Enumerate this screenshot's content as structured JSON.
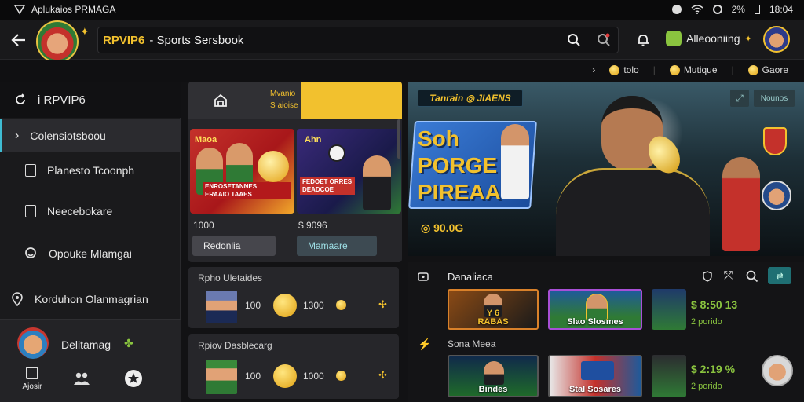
{
  "status_bar": {
    "app_title": "Aplukaios PRMAGA",
    "battery": "2%",
    "time": "18:04"
  },
  "top_bar": {
    "brand": "RPVIP6",
    "subtitle": "- Sports Sersbook",
    "account_label": "Alleooniing"
  },
  "sub_bar": {
    "items": [
      "tolo",
      "Mutique",
      "Gaore"
    ]
  },
  "sidebar": {
    "header": "i RPVIP6",
    "items": [
      "Colensiotsboou",
      "Planesto Tcoonph",
      "Neecebokare",
      "Opouke Mlamgai"
    ],
    "footer_item": "Korduhon Olanmagrian",
    "profile_name": "Delitamag",
    "bottom_label": "Ajosir"
  },
  "promo": {
    "tab_text": "Mvanio\nS aioise",
    "cards": [
      {
        "top": "Maoa",
        "banner": "ENROSETANNES\nERAAIO TAAES",
        "amount": "1000",
        "button": "Redonlia"
      },
      {
        "top": "Ahn",
        "banner": "FEDOET ORRES\nDEADCOE",
        "amount": "$ 9096",
        "button": "Mamaare"
      }
    ]
  },
  "rows": [
    {
      "title": "Rpho Uletaides",
      "value1": "100",
      "value2": "1300"
    },
    {
      "title": "Rpiov Dasblecarg",
      "value1": "100",
      "value2": "1000"
    }
  ],
  "hero": {
    "tag": "Tanrain ◎ JIAENS",
    "headline": "Soh PORGE PIREAA",
    "price": "◎ 90.0G",
    "button": "Nounos"
  },
  "games": {
    "header": "Danaliaca",
    "subheader": "Sona Meea",
    "row1": [
      {
        "label": "Y 6\nRABAS",
        "style": "orange"
      },
      {
        "label": "Slao Slosmes",
        "style": "purple"
      }
    ],
    "row1_price": "$ 8:50 13",
    "row1_sub": "2 porido",
    "row2": [
      {
        "label": "Bindes",
        "style": "green"
      },
      {
        "label": "Stal Sosares",
        "style": "blue"
      }
    ],
    "row2_price": "$ 2:19 %",
    "row2_sub": "2 porido"
  },
  "colors": {
    "accent": "#f2c12e",
    "green": "#8ac43f",
    "teal_button": "#1f6f73",
    "background": "#121214"
  }
}
